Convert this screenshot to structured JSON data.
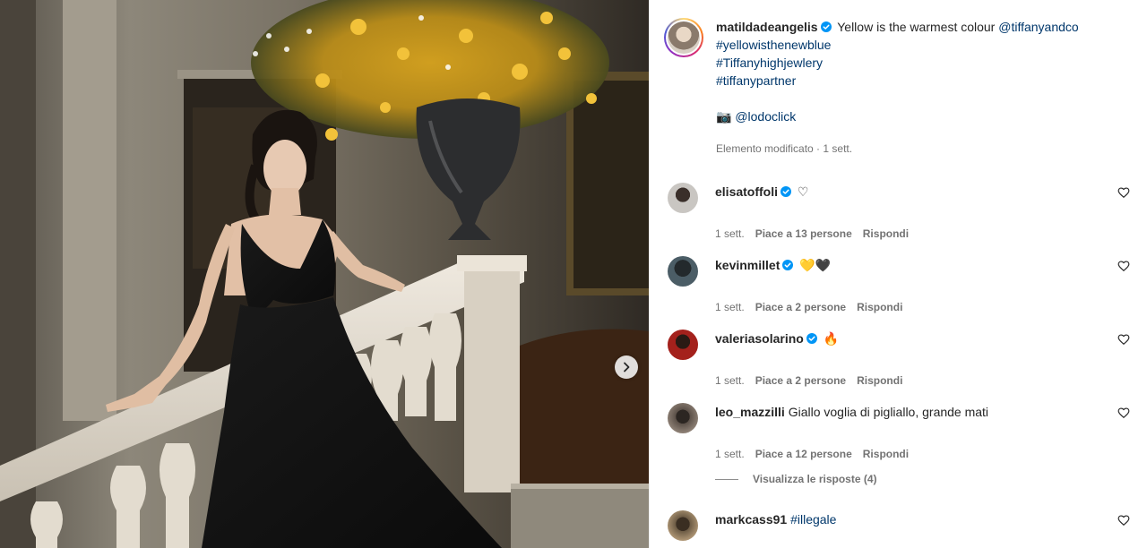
{
  "post": {
    "author": "matildadeangelis",
    "verified": true,
    "caption_text": "Yellow is the warmest colour",
    "caption_mention": "@tiffanyandco",
    "hashtags": [
      "#yellowisthenewblue",
      "#Tiffanyhighjewlery",
      "#tiffanypartner"
    ],
    "photo_credit_icon": "camera-emoji",
    "photo_credit_glyph": "📷",
    "photo_credit_mention": "@lodoclick",
    "edited_label": "Elemento modificato · 1 sett."
  },
  "comments": [
    {
      "user": "elisatoffoli",
      "verified": true,
      "text": "",
      "emoji": "♡",
      "time": "1 sett.",
      "likes": "Piace a 13 persone",
      "reply": "Rispondi",
      "avatar_color": "#c9c6c2"
    },
    {
      "user": "kevinmillet",
      "verified": true,
      "text": "",
      "emoji": "💛🖤",
      "time": "1 sett.",
      "likes": "Piace a 2 persone",
      "reply": "Rispondi",
      "avatar_color": "#3b4b52"
    },
    {
      "user": "valeriasolarino",
      "verified": true,
      "text": "",
      "emoji": "🔥",
      "time": "1 sett.",
      "likes": "Piace a 2 persone",
      "reply": "Rispondi",
      "avatar_color": "#a4211c"
    },
    {
      "user": "leo_mazzilli",
      "verified": false,
      "text": "Giallo voglia di pigliallo, grande mati",
      "emoji": "",
      "time": "1 sett.",
      "likes": "Piace a 12 persone",
      "reply": "Rispondi",
      "avatar_color": "#5b5048"
    },
    {
      "user": "markcass91",
      "verified": false,
      "text": "",
      "hashtag": "#illegale",
      "emoji": "",
      "avatar_color": "#6b5a44"
    }
  ],
  "view_replies": "Visualizza le risposte (4)",
  "colors": {
    "text": "#262626",
    "meta": "#737373",
    "link": "#00376b",
    "verified": "#0095f6"
  }
}
